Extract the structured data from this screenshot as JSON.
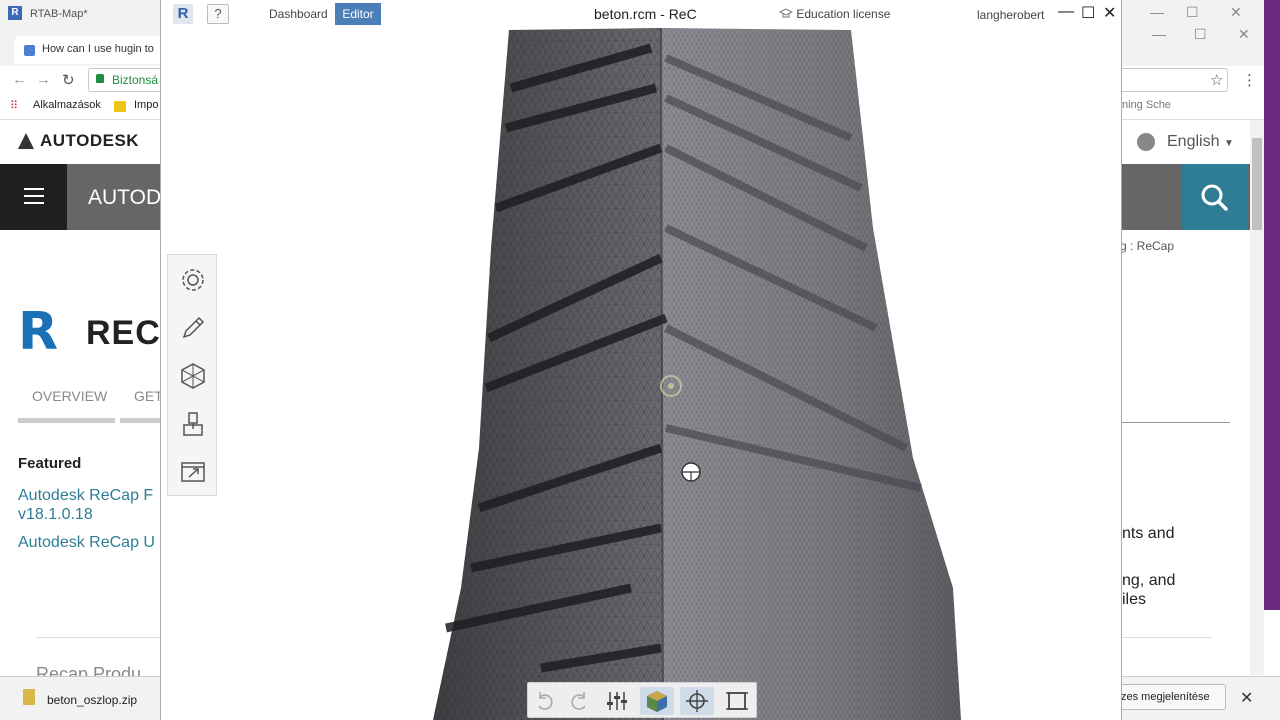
{
  "background_window": {
    "title": "RTAB-Map*",
    "tab_title": "How can I use hugin to",
    "secure_label": "Biztonsá",
    "bookmarks": [
      "Alkalmazások",
      "Impo"
    ],
    "bookmark_right": "ning Sche",
    "brand": "AUTODESK",
    "nav_title": "AUTOD",
    "language": "English",
    "breadcrumb": "g  :  ReCap",
    "product_title": "RECA",
    "subnav": [
      "OVERVIEW",
      "GET"
    ],
    "featured_heading": "Featured",
    "featured_links": [
      "Autodesk ReCap F",
      "v18.1.0.18",
      "Autodesk ReCap U"
    ],
    "right_text": [
      "nts and",
      "ng, and",
      "iles"
    ],
    "bottom_heading": "Recap Produ",
    "download_file": "beton_oszlop.zip",
    "download_show_all": "zes megjelenítése"
  },
  "recap": {
    "logo": "R",
    "help": "?",
    "tabs": {
      "dashboard": "Dashboard",
      "editor": "Editor"
    },
    "title": "beton.rcm - ReC",
    "license": "Education license",
    "user": "langherobert",
    "window_controls": {
      "minimize": "—",
      "maximize": "☐",
      "close": "✕"
    },
    "palette_tools": [
      "settings-icon",
      "pencil-icon",
      "mesh-icon",
      "measure-icon",
      "export-icon"
    ],
    "bottom_tools": [
      "undo-icon",
      "redo-icon",
      "adjust-icon",
      "cube-view-icon",
      "target-icon",
      "frame-icon"
    ],
    "accent": "#4a7fb8"
  }
}
